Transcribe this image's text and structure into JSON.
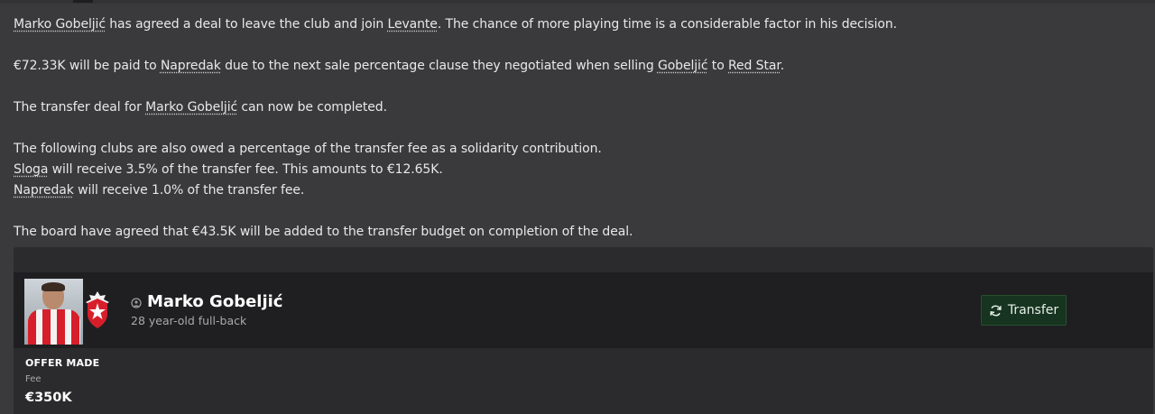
{
  "message": {
    "line1": {
      "player": "Marko Gobeljić",
      "text_a": " has agreed a deal to leave the club and join ",
      "club": "Levante",
      "text_b": ". The chance of more playing time is a considerable factor in his decision."
    },
    "line2": {
      "amount": "€72.33K will be paid to ",
      "club": "Napredak",
      "text_a": " due to the next sale percentage clause they negotiated when selling ",
      "player": "Gobeljić",
      "text_b": " to ",
      "club2": "Red Star",
      "text_c": "."
    },
    "line3": {
      "text_a": "The transfer deal for ",
      "player": "Marko Gobeljić",
      "text_b": " can now be completed."
    },
    "line4": {
      "text": "The following clubs are also owed a percentage of the transfer fee as a solidarity contribution."
    },
    "line5": {
      "club": "Sloga",
      "text": " will receive 3.5% of the transfer fee. This amounts to €12.65K."
    },
    "line6": {
      "club": "Napredak",
      "text": " will receive 1.0% of the transfer fee."
    },
    "line7": {
      "text": "The board have agreed that €43.5K will be added to the transfer budget on completion of the deal."
    }
  },
  "card": {
    "player_name": "Marko Gobeljić",
    "player_desc": "28 year-old full-back",
    "transfer_button": "Transfer",
    "offer_title": "OFFER MADE",
    "fee_label": "Fee",
    "fee_value": "€350K",
    "icons": {
      "person": "person-icon",
      "badge": "red-star-badge",
      "transfer": "refresh-icon"
    },
    "colors": {
      "button_bg": "#16341f",
      "badge_red": "#d71f2b"
    }
  }
}
